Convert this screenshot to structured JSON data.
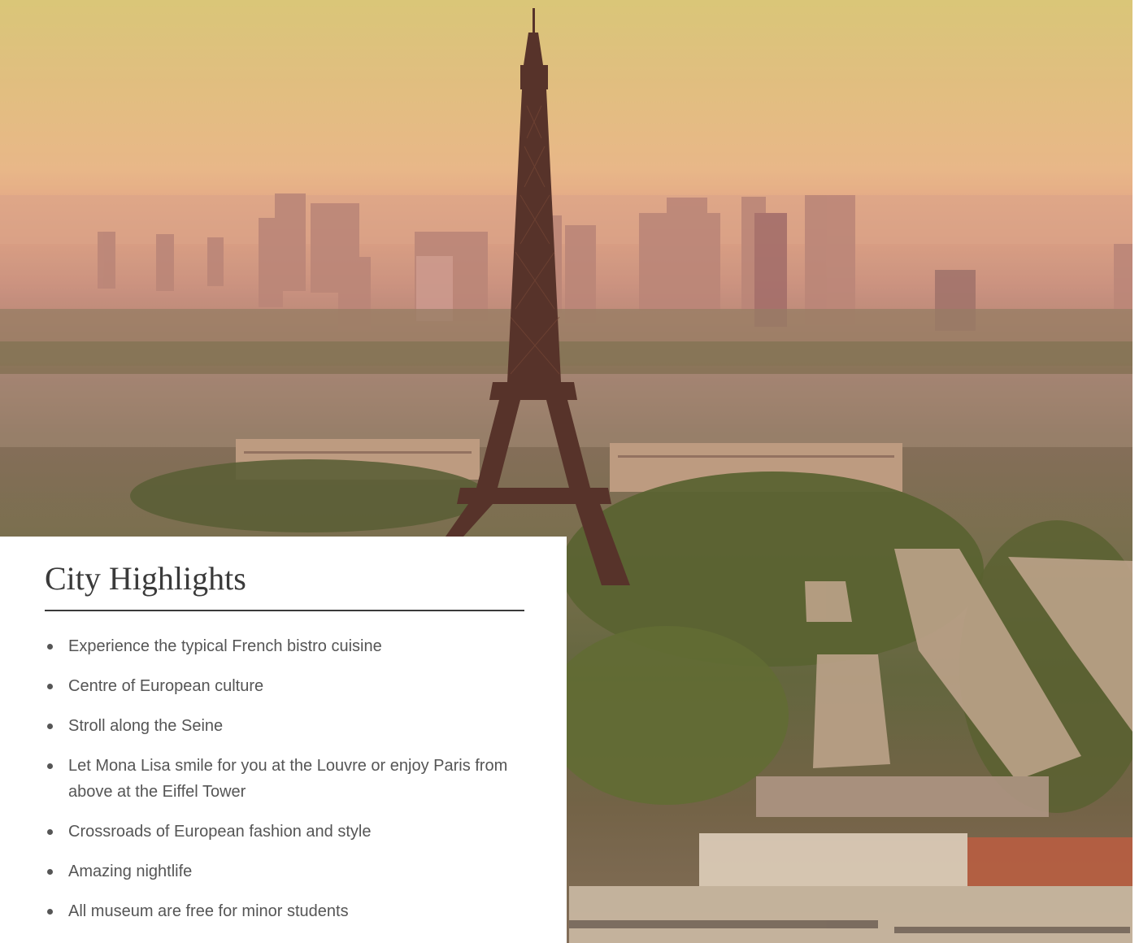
{
  "photo": {
    "icon": "paris-skyline-eiffel-tower-photo"
  },
  "highlights_card": {
    "title": "City Highlights",
    "items": [
      "Experience the typical French bistro cuisine",
      "Centre of European culture",
      "Stroll along the Seine",
      "Let Mona Lisa smile for you at the Louvre or enjoy Paris from above at the Eiffel Tower",
      "Crossroads of European fashion and style",
      "Amazing nightlife",
      "All museum are free for minor students"
    ]
  },
  "colors": {
    "sky_top": "#d8c979",
    "sky_haze": "#e8b98a",
    "tower": "#4a2a24",
    "text": "#555555",
    "title": "#3a3a3a"
  }
}
